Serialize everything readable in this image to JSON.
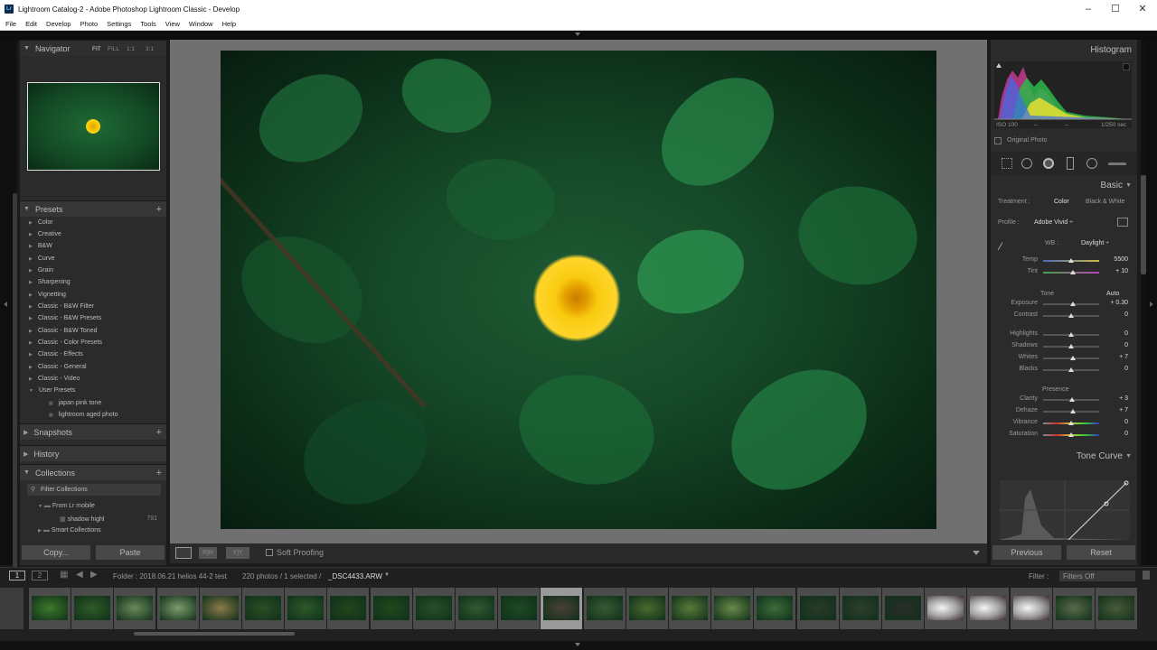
{
  "window": {
    "title": "Lightroom Catalog-2 - Adobe Photoshop Lightroom Classic - Develop"
  },
  "menu": [
    "File",
    "Edit",
    "Develop",
    "Photo",
    "Settings",
    "Tools",
    "View",
    "Window",
    "Help"
  ],
  "left": {
    "navigator": {
      "title": "Navigator",
      "modes": [
        "FIT",
        "FILL",
        "1:1",
        "3:1"
      ]
    },
    "presets": {
      "title": "Presets",
      "items": [
        "Color",
        "Creative",
        "B&W",
        "Curve",
        "Grain",
        "Sharpening",
        "Vignetting",
        "Classic - B&W Filter",
        "Classic - B&W Presets",
        "Classic - B&W Toned",
        "Classic - Color Presets",
        "Classic - Effects",
        "Classic - General",
        "Classic - Video",
        "User Presets"
      ],
      "user_items": [
        "japan pink tone",
        "lightroom aged photo"
      ]
    },
    "snapshots": "Snapshots",
    "history": "History",
    "collections": {
      "title": "Collections",
      "filter": "Filter Collections",
      "items": [
        {
          "label": "From Lr mobile",
          "count": ""
        },
        {
          "label": "shadow highl",
          "count": "791"
        },
        {
          "label": "Smart Collections",
          "count": ""
        }
      ]
    },
    "copy": "Copy...",
    "paste": "Paste"
  },
  "toolbar": {
    "soft_proofing": "Soft Proofing"
  },
  "right": {
    "histogram": {
      "title": "Histogram",
      "iso": "ISO 100",
      "dash1": "–",
      "dash2": "–",
      "shutter": "1/250 sec",
      "original": "Original Photo"
    },
    "basic": {
      "title": "Basic",
      "treatment_label": "Treatment :",
      "color": "Color",
      "bw": "Black & White",
      "profile_label": "Profile :",
      "profile": "Adobe Vivid ÷",
      "wb_label": "WB :",
      "wb": "Daylight ÷",
      "tone": "Tone",
      "auto": "Auto",
      "presence": "Presence",
      "sliders": [
        {
          "label": "Temp",
          "value": "5500",
          "pos": 0.5
        },
        {
          "label": "Tint",
          "value": "+ 10",
          "pos": 0.54
        },
        {
          "label": "Exposure",
          "value": "+ 0.30",
          "pos": 0.53
        },
        {
          "label": "Contrast",
          "value": "0",
          "pos": 0.5
        },
        {
          "label": "Highlights",
          "value": "0",
          "pos": 0.5
        },
        {
          "label": "Shadows",
          "value": "0",
          "pos": 0.5
        },
        {
          "label": "Whites",
          "value": "+ 7",
          "pos": 0.53
        },
        {
          "label": "Blacks",
          "value": "0",
          "pos": 0.5
        },
        {
          "label": "Clarity",
          "value": "+ 3",
          "pos": 0.52
        },
        {
          "label": "Dehaze",
          "value": "+ 7",
          "pos": 0.53
        },
        {
          "label": "Vibrance",
          "value": "0",
          "pos": 0.5
        },
        {
          "label": "Saturation",
          "value": "0",
          "pos": 0.5
        }
      ]
    },
    "tone_curve": "Tone Curve",
    "previous": "Previous",
    "reset": "Reset"
  },
  "filmbar": {
    "page1": "1",
    "page2": "2",
    "folder": "Folder : 2018.06.21 helios 44-2 test",
    "count": "220 photos / 1 selected /",
    "file": "_DSC4433.ARW",
    "filter_label": "Filter :",
    "filter_value": "Filters Off"
  },
  "filmstrip": {
    "thumbs": [
      "#3d7a2a",
      "#2f5c26",
      "#6c8a5a",
      "#7f9c6b",
      "#8a7a4a",
      "#2c4f24",
      "#2d5a2a",
      "#22461c",
      "#1f4a1c",
      "#26502a",
      "#305a30",
      "#1d4a24",
      "#4a4038",
      "#3a5a34",
      "#4a6a30",
      "#5a7a3a",
      "#6a8a4a",
      "#3c6c3a",
      "#2a3a2a",
      "#2e3e2e",
      "#2a2e2a",
      "#c8c8c8",
      "#d0d0d0",
      "#cfcfcf",
      "#5a6a4a",
      "#4a5a3a"
    ],
    "selected_index": 12
  }
}
